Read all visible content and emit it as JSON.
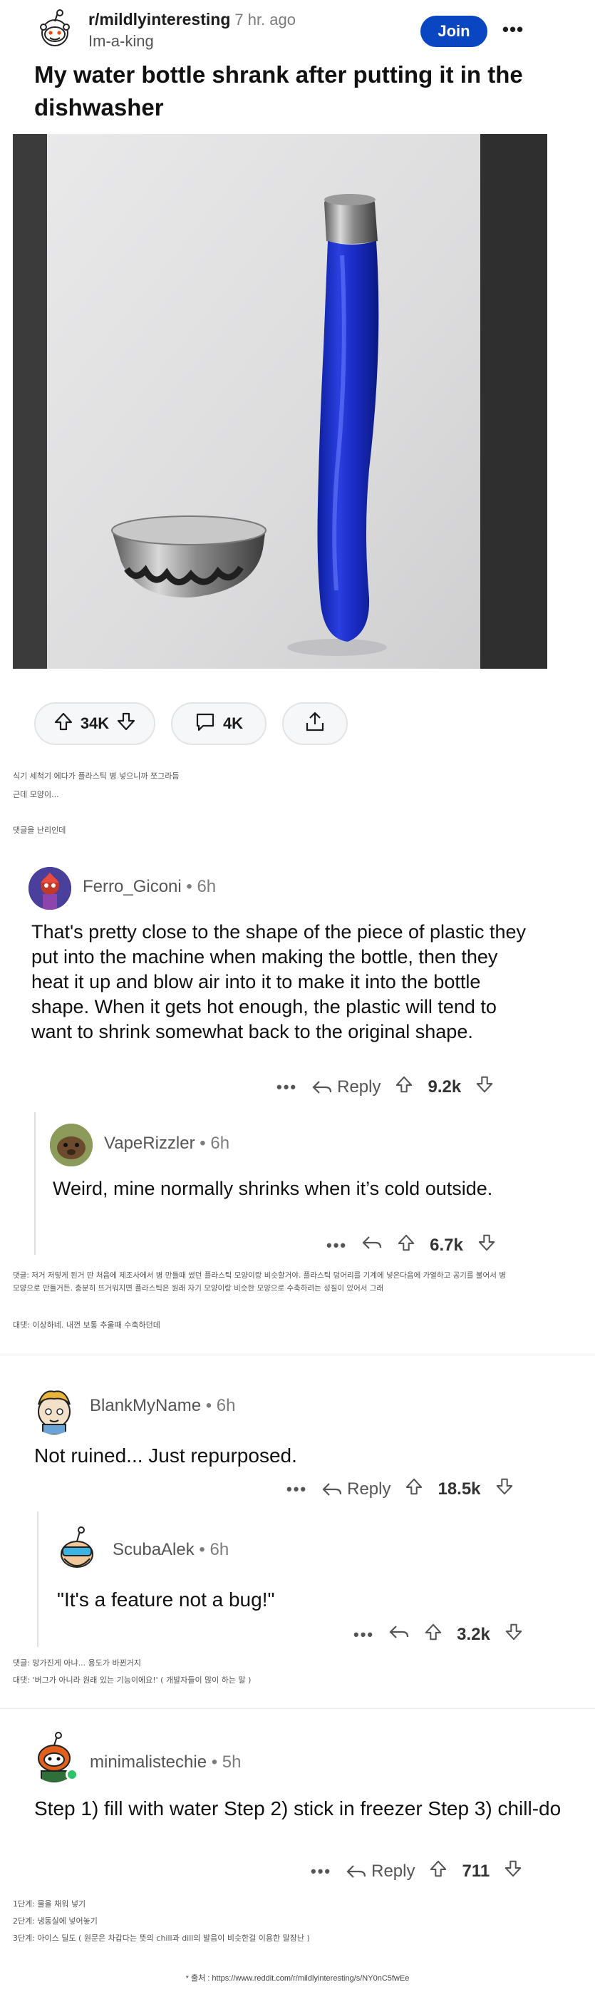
{
  "post": {
    "subreddit": "r/mildlyinteresting",
    "time": "7 hr. ago",
    "author": "Im-a-king",
    "join_label": "Join",
    "more_label": "•••",
    "title": "My water bottle shrank after putting it in the dishwasher",
    "upvotes": "34K",
    "comments": "4K"
  },
  "caption": {
    "line1": "식기 세척기 에다가 플라스틱 병 넣으니까 쪼그라듬",
    "line2": "근데 모양이...",
    "line3": "댓글을 난리인데"
  },
  "comments": [
    {
      "user": "Ferro_Giconi",
      "age": " • 6h",
      "body": "That's pretty close to the shape of the piece of plastic they put into the machine when making the bottle, then they heat it up and blow air into it to make it into the bottle shape. When it gets hot enough, the plastic will tend to want to shrink somewhat back to the original shape.",
      "reply_label": "Reply",
      "score": "9.2k"
    },
    {
      "user": "VapeRizzler",
      "age": " • 6h",
      "body": "Weird, mine normally shrinks when it’s cold outside.",
      "score": "6.7k"
    },
    {
      "user": "BlankMyName",
      "age": " • 6h",
      "body": "Not ruined... Just repurposed.",
      "reply_label": "Reply",
      "score": "18.5k"
    },
    {
      "user": "ScubaAlek",
      "age": " • 6h",
      "body": "\"It's a feature not a bug!\"",
      "score": "3.2k"
    },
    {
      "user": "minimalistechie",
      "age": " • 5h",
      "body": "Step 1) fill with water Step 2) stick in freezer Step 3) chill-do",
      "reply_label": "Reply",
      "score": "711"
    }
  ],
  "notes": {
    "n1a": "댓글: 저거 저렇게 된거 딴 처음에 제조사에서 병 만들때 썼던 플라스틱 모양이랑 비슷할거야. 플라스틱 덩어리를 기계에 넣은다음에 가열하고 공기를 불어서 병",
    "n1b": "모양으로 만들거든. 충분히 뜨거워지면 플라스틱은 원래 자기 모양이랑 비슷한 모양으로 수축하려는 성질이 있어서 그래",
    "n2": "대댓: 이상하네. 내껀 보통 추울때 수축하던데",
    "n3": "댓글: 망가진게 아냐... 용도가 바뀐거지",
    "n4": "대댓: '버그가 아니라 원래 있는 기능이에요!' ( 개발자들이 많이 하는 말 )",
    "n5": "1단계: 물을 채워 넣기",
    "n6": "2단계: 냉동실에 넣어놓기",
    "n7": "3단계: 아이스 딜도 ( 원문은 차갑다는 뜻의 chill과 dill의 발음이 비슷한걸 이용한 말장난 )"
  },
  "source": "* 출처 : https://www.reddit.com/r/mildlyinteresting/s/NY0nC5fwEe",
  "colors": {
    "join": "#0a45c2",
    "text": "#1c1c1c",
    "muted": "#7c7c7c",
    "online": "#2dc26b"
  }
}
